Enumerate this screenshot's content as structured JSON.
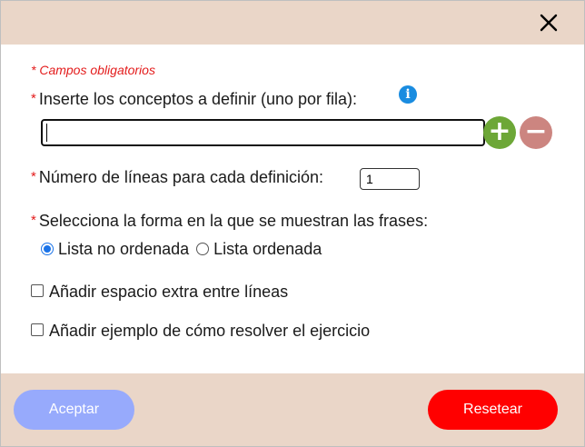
{
  "header": {
    "close_icon": "close-x-icon"
  },
  "form": {
    "required_note": "* Campos obligatorios",
    "required_mark": "*",
    "concepts_label": "Inserte los conceptos a definir (uno por fila):",
    "info_icon": "info-icon",
    "info_glyph": "i",
    "concept_value": "",
    "add_glyph": "+",
    "remove_glyph": "−",
    "lines_label": "Número de líneas para cada definición:",
    "lines_value": "1",
    "display_label": "Selecciona la forma en la que se muestran las frases:",
    "display_options": [
      {
        "label": "Lista no ordenada",
        "checked": true
      },
      {
        "label": "Lista ordenada",
        "checked": false
      }
    ],
    "extra_space_label": "Añadir espacio extra entre líneas",
    "extra_space_checked": false,
    "example_label": "Añadir ejemplo de cómo resolver el ejercicio",
    "example_checked": false
  },
  "footer": {
    "accept_label": "Aceptar",
    "reset_label": "Resetear"
  },
  "colors": {
    "header_bg": "#ead6c8",
    "required": "#e31b1b",
    "add_button": "#6da737",
    "remove_button": "#cc8580",
    "accept_button": "#97aafc",
    "reset_button": "#ff0000",
    "radio_accent": "#1a73e8",
    "info_icon": "#1a8ce0"
  }
}
